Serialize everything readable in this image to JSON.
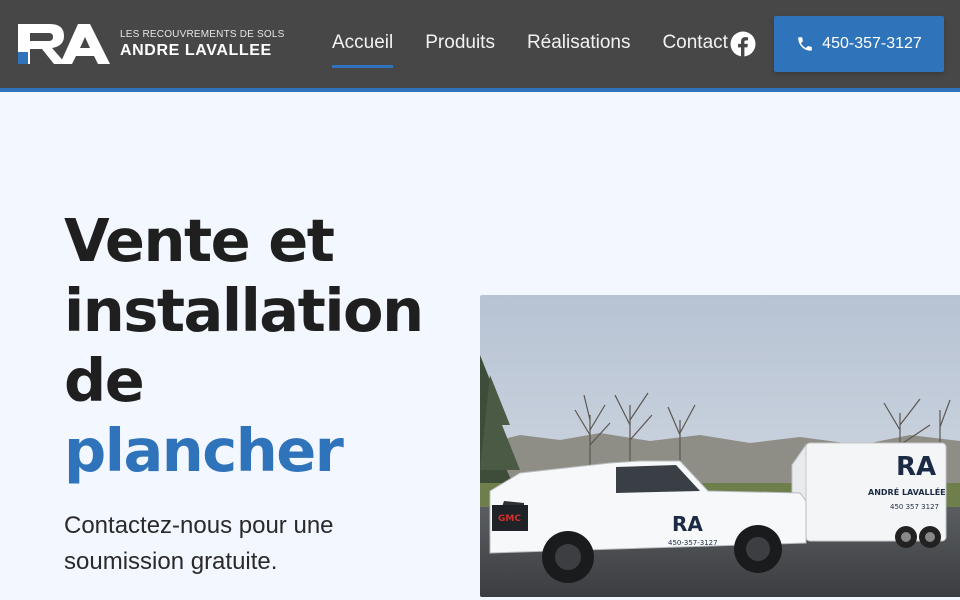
{
  "header": {
    "logo": {
      "monogram": "RA",
      "line1": "LES RECOUVREMENTS DE SOLS",
      "line2": "ANDRE LAVALLEE"
    },
    "nav": [
      {
        "label": "Accueil",
        "active": true
      },
      {
        "label": "Produits",
        "active": false
      },
      {
        "label": "Réalisations",
        "active": false
      },
      {
        "label": "Contact",
        "active": false
      }
    ],
    "facebook_icon": "facebook-icon",
    "phone_button": {
      "label": "450-357-3127",
      "icon": "phone-icon"
    },
    "colors": {
      "background": "#474747",
      "accent": "#2f74ba"
    }
  },
  "hero": {
    "title_line1": "Vente et",
    "title_line2": "installation",
    "title_line3": "de",
    "title_accent": "plancher",
    "subtitle": "Contactez-nous pour une soumission gratuite.",
    "image": {
      "truck_text": "450-357-3127",
      "trailer_text_1": "ANDRÉ LAVALLÉE",
      "trailer_text_2": "450 357 3127"
    }
  },
  "colors": {
    "page_background": "#f3f7ff",
    "text": "#1f1f1f"
  }
}
